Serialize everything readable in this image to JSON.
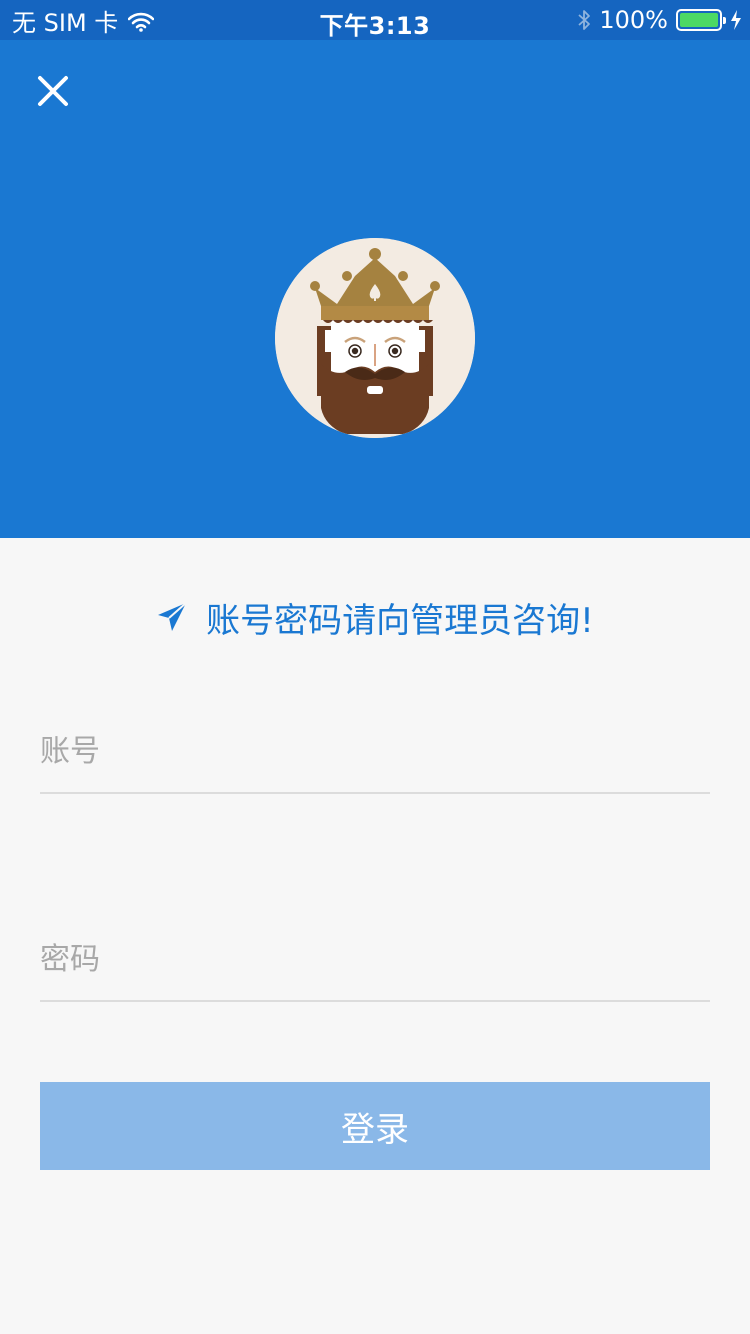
{
  "status_bar": {
    "carrier": "无 SIM 卡",
    "time": "下午3:13",
    "battery_text": "100%",
    "battery_level": 1.0,
    "battery_color": "#4cd964"
  },
  "header": {
    "background_color": "#1a78d2",
    "close_icon": "close-icon",
    "avatar_icon": "king-avatar"
  },
  "notice": {
    "icon": "send-icon",
    "text": "账号密码请向管理员咨询!"
  },
  "form": {
    "account_placeholder": "账号",
    "account_value": "",
    "password_placeholder": "密码",
    "password_value": "",
    "login_label": "登录",
    "login_color": "#8ab8e8"
  }
}
